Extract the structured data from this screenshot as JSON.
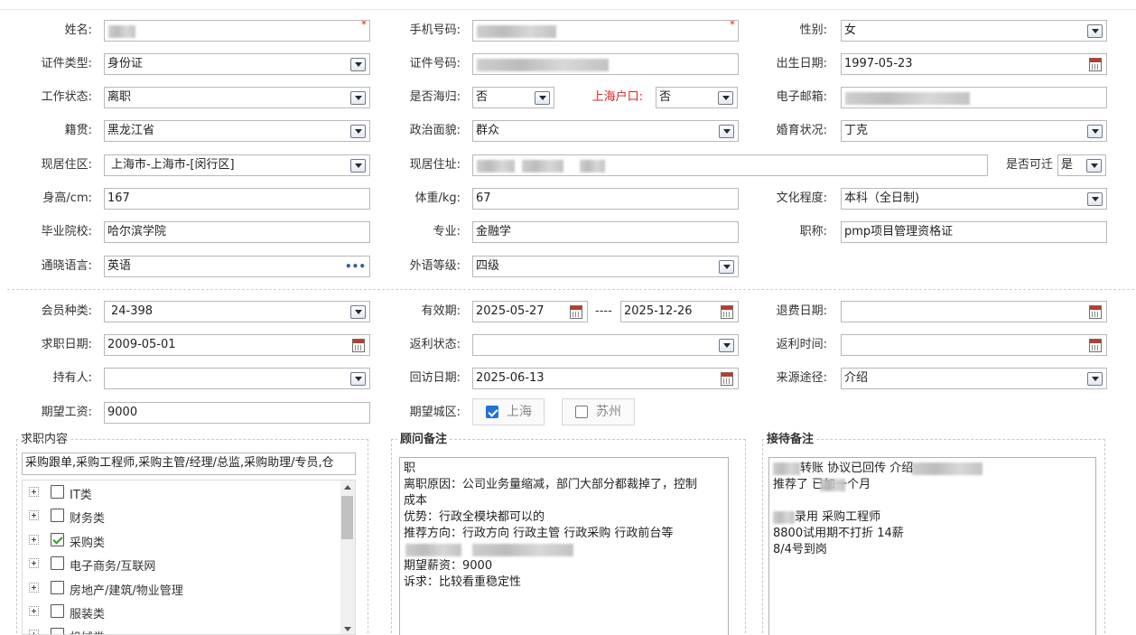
{
  "fields": {
    "name": {
      "label": "姓名:",
      "required": "*"
    },
    "phone": {
      "label": "手机号码:",
      "required": "*"
    },
    "gender": {
      "label": "性别:",
      "value": "女"
    },
    "id_type": {
      "label": "证件类型:",
      "value": "身份证"
    },
    "id_number": {
      "label": "证件号码:"
    },
    "birth_date": {
      "label": "出生日期:",
      "value": "1997-05-23"
    },
    "work_status": {
      "label": "工作状态:",
      "value": "离职"
    },
    "overseas": {
      "label": "是否海归:",
      "value": "否"
    },
    "sh_hukou": {
      "label": "上海户口:",
      "value": "否"
    },
    "email": {
      "label": "电子邮箱:"
    },
    "native_place": {
      "label": "籍贯:",
      "value": "黑龙江省"
    },
    "political": {
      "label": "政治面貌:",
      "value": "群众"
    },
    "marital": {
      "label": "婚育状况:",
      "value": "丁克"
    },
    "residence_area": {
      "label": "现居住区:",
      "value": "上海市-上海市-[闵行区]"
    },
    "address": {
      "label": "现居住址:"
    },
    "relocate": {
      "label": "是否可迁",
      "value": "是"
    },
    "height": {
      "label": "身高/cm:",
      "value": "167"
    },
    "weight": {
      "label": "体重/kg:",
      "value": "67"
    },
    "education": {
      "label": "文化程度:",
      "value": "本科（全日制)"
    },
    "school": {
      "label": "毕业院校:",
      "value": "哈尔滨学院"
    },
    "major": {
      "label": "专业:",
      "value": "金融学"
    },
    "title": {
      "label": "职称:",
      "value": "pmp项目管理资格证"
    },
    "languages": {
      "label": "通晓语言:",
      "value": "英语"
    },
    "foreign_level": {
      "label": "外语等级:",
      "value": "四级"
    },
    "member_type": {
      "label": "会员种类:",
      "value": "24-398"
    },
    "validity": {
      "label": "有效期:",
      "start": "2025-05-27",
      "sep": "----",
      "end": "2025-12-26"
    },
    "refund_date": {
      "label": "退费日期:",
      "value": ""
    },
    "job_date": {
      "label": "求职日期:",
      "value": "2009-05-01"
    },
    "rebate_status": {
      "label": "返利状态:",
      "value": ""
    },
    "rebate_time": {
      "label": "返利时间:",
      "value": ""
    },
    "holder": {
      "label": "持有人:",
      "value": ""
    },
    "visit_date": {
      "label": "回访日期:",
      "value": "2025-06-13"
    },
    "source": {
      "label": "来源途径:",
      "value": "介绍"
    },
    "expected_salary": {
      "label": "期望工资:",
      "value": "9000"
    },
    "expected_city": {
      "label": "期望城区:",
      "options": [
        "上海",
        "苏州"
      ],
      "selected": "上海"
    }
  },
  "job_panel": {
    "title": "求职内容",
    "summary": "采购跟单,采购工程师,采购主管/经理/总监,采购助理/专员,仓",
    "tree": [
      {
        "label": "IT类",
        "checked": false
      },
      {
        "label": "财务类",
        "checked": false
      },
      {
        "label": "采购类",
        "checked": true
      },
      {
        "label": "电子商务/互联网",
        "checked": false
      },
      {
        "label": "房地产/建筑/物业管理",
        "checked": false
      },
      {
        "label": "服装类",
        "checked": false
      },
      {
        "label": "机械类",
        "checked": false
      }
    ]
  },
  "advisor_panel": {
    "title": "顾问备注",
    "lines": [
      "职",
      "离职原因：公司业务量缩减，部门大部分都裁掉了，控制",
      "成本",
      "优势：行政全模块都可以的",
      "推荐方向：行政方向 行政主管 行政采购 行政前台等",
      "",
      "期望薪资：9000",
      "诉求：比较看重稳定性"
    ]
  },
  "reception_panel": {
    "title": "接待备注",
    "lines": [
      " 转账 协议已回传 介绍",
      "推荐了 已加一个月",
      "",
      "录用 采购工程师",
      "8800试用期不打折 14薪",
      "8/4号到岗"
    ]
  }
}
